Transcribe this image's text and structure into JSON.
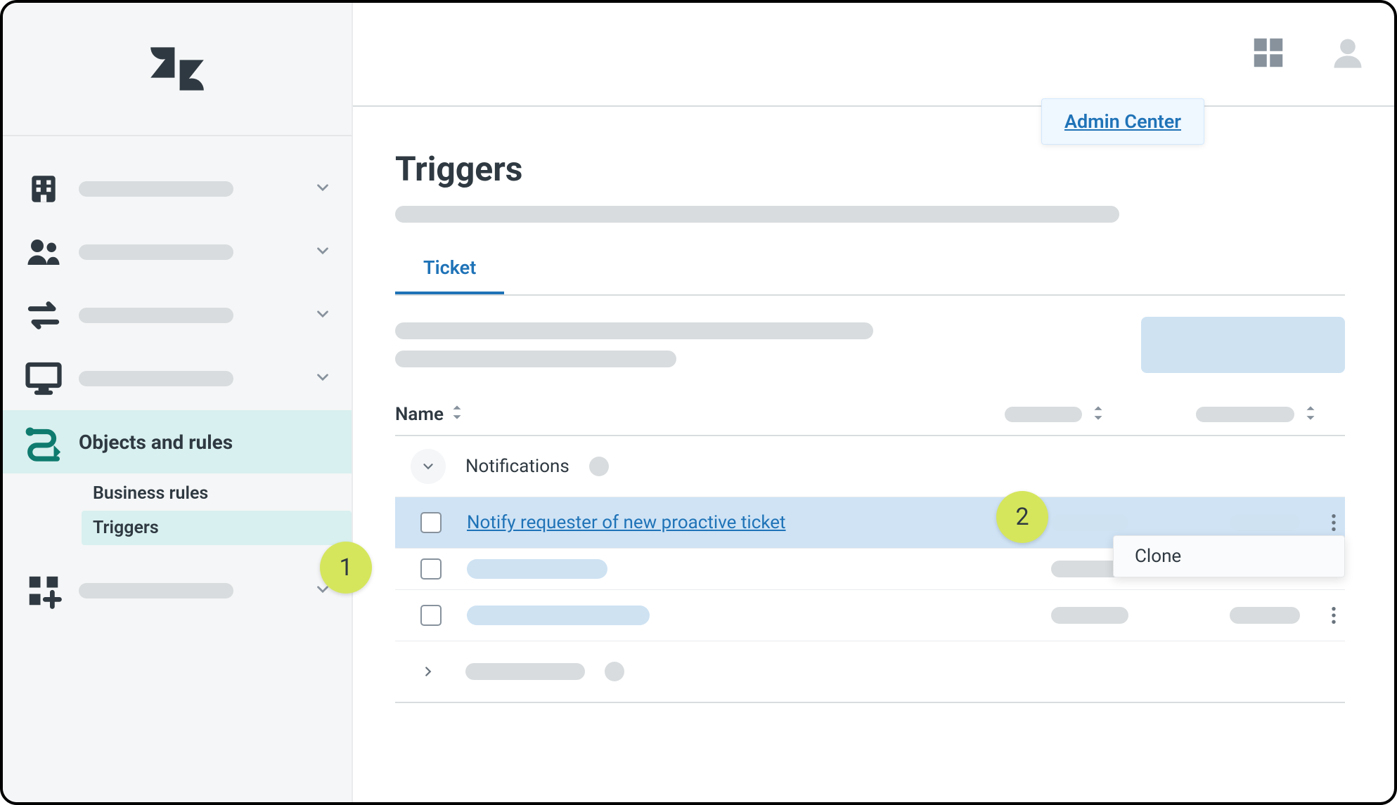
{
  "header": {
    "admin_center_label": "Admin Center"
  },
  "sidebar": {
    "items": [
      {
        "label": "Objects and rules"
      }
    ],
    "sub_business_rules": "Business rules",
    "sub_triggers": "Triggers"
  },
  "page": {
    "title": "Triggers",
    "tab_ticket": "Ticket"
  },
  "table": {
    "col_name": "Name",
    "category_notifications": "Notifications",
    "row_highlight_link": "Notify requester of new proactive ticket",
    "clone_label": "Clone"
  },
  "annotations": {
    "badge1": "1",
    "badge2": "2"
  }
}
